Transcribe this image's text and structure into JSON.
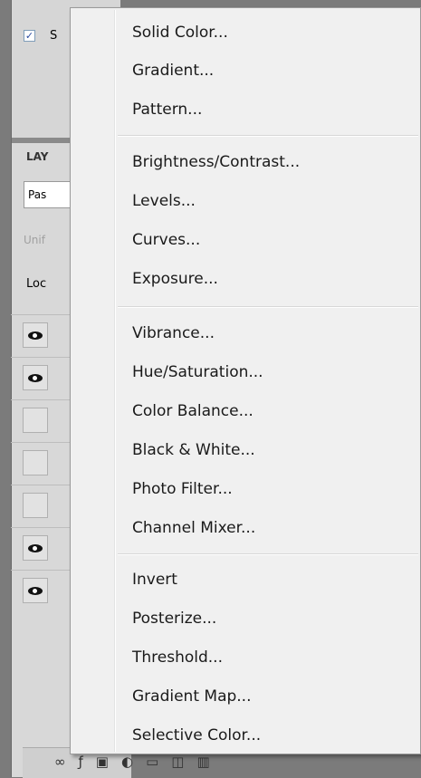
{
  "panel": {
    "checkbox_label": "S",
    "checkbox_checked_glyph": "✓",
    "layers_title": "LAY",
    "blend_mode": "Pas",
    "unify_label": "Unif",
    "lock_label": "Loc",
    "layer_rows": [
      {
        "visible": true
      },
      {
        "visible": true
      },
      {
        "visible": false
      },
      {
        "visible": false
      },
      {
        "visible": false
      },
      {
        "visible": true
      },
      {
        "visible": true
      }
    ],
    "bottom_icons": [
      "link-icon",
      "fx-icon",
      "mask-icon",
      "adjustment-icon",
      "folder-icon",
      "new-layer-icon",
      "trash-icon"
    ]
  },
  "menu": {
    "groups": [
      [
        "Solid Color...",
        "Gradient...",
        "Pattern..."
      ],
      [
        "Brightness/Contrast...",
        "Levels...",
        "Curves...",
        "Exposure..."
      ],
      [
        "Vibrance...",
        "Hue/Saturation...",
        "Color Balance...",
        "Black & White...",
        "Photo Filter...",
        "Channel Mixer..."
      ],
      [
        "Invert",
        "Posterize...",
        "Threshold...",
        "Gradient Map...",
        "Selective Color..."
      ]
    ]
  }
}
